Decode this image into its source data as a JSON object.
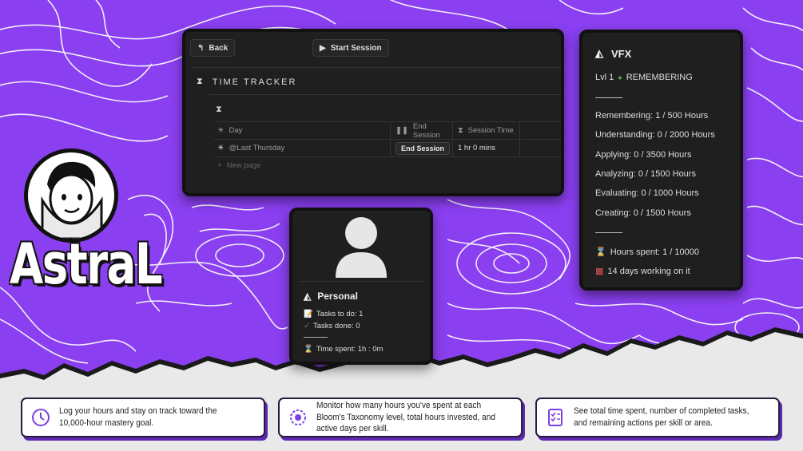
{
  "brand": {
    "name": "AstraL"
  },
  "colors": {
    "purple": "#8a3ff0",
    "panel": "#1f1f1f",
    "accent_dark": "#111111"
  },
  "tracker": {
    "back_label": "Back",
    "start_session_label": "Start Session",
    "title": "TIME TRACKER",
    "columns": {
      "day": "Day",
      "end_session": "End Session",
      "session_time": "Session Time"
    },
    "row": {
      "day": "@Last Thursday",
      "end_button": "End Session",
      "session_time": "1 hr  0 mins"
    },
    "new_page_label": "New page"
  },
  "personal": {
    "title": "Personal",
    "tasks_todo": "Tasks to do: 1",
    "tasks_done": "Tasks done: 0",
    "time_spent": "Time spent: 1h : 0m"
  },
  "vfx": {
    "title": "VFX",
    "level": "Lvl 1",
    "stage": "REMEMBERING",
    "skills": [
      "Remembering: 1 / 500 Hours",
      "Understanding: 0 / 2000 Hours",
      "Applying: 0 / 3500 Hours",
      "Analyzing: 0 / 1500 Hours",
      "Evaluating: 0 / 1000 Hours",
      "Creating: 0 / 1500 Hours"
    ],
    "hours_spent": "Hours spent: 1 / 10000",
    "days_working": "14 days working on it"
  },
  "features": [
    {
      "icon": "clock-icon",
      "text": "Log your hours and stay on track toward the 10,000-hour mastery goal."
    },
    {
      "icon": "brain-gear-icon",
      "text": "Monitor how many hours you've spent at each Bloom's Taxonomy level, total hours invested, and active days per skill."
    },
    {
      "icon": "checklist-icon",
      "text": "See total time spent, number of completed tasks, and remaining actions per skill or area."
    }
  ]
}
